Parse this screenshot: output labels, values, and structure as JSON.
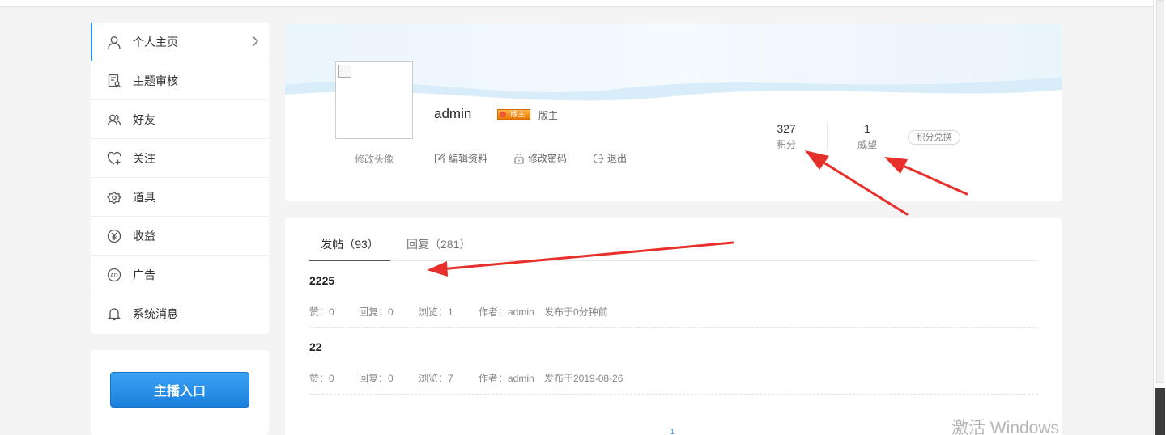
{
  "sidebar": {
    "items": [
      {
        "label": "个人主页",
        "icon": "user-icon",
        "active": true
      },
      {
        "label": "主题审核",
        "icon": "review-icon"
      },
      {
        "label": "好友",
        "icon": "friends-icon"
      },
      {
        "label": "关注",
        "icon": "heart-plus-icon"
      },
      {
        "label": "道具",
        "icon": "tools-icon"
      },
      {
        "label": "收益",
        "icon": "yen-icon"
      },
      {
        "label": "广告",
        "icon": "ad-icon"
      },
      {
        "label": "系统消息",
        "icon": "bell-icon"
      }
    ],
    "live_button": "主播入口"
  },
  "profile": {
    "username": "admin",
    "badge": "版主",
    "role": "版主",
    "edit_avatar": "修改头像",
    "actions": {
      "edit_profile": "编辑资料",
      "change_password": "修改密码",
      "logout": "退出"
    },
    "stats": {
      "points_value": "327",
      "points_label": "积分",
      "prestige_value": "1",
      "prestige_label": "威望"
    },
    "exchange": "积分兑换"
  },
  "posts": {
    "tabs": {
      "threads": "发帖（93）",
      "replies": "回复（281）"
    },
    "items": [
      {
        "title": "2225",
        "likes": "赞：0",
        "replies": "回复：0",
        "views": "浏览：1",
        "author": "作者：admin",
        "time": "发布于0分钟前"
      },
      {
        "title": "22",
        "likes": "赞：0",
        "replies": "回复：0",
        "views": "浏览：7",
        "author": "作者：admin",
        "time": "发布于2019-08-26"
      }
    ],
    "page": "1"
  },
  "watermark": "激活 Windows",
  "colors": {
    "accent": "#2b8fe8",
    "annotation_arrow": "#e8302a",
    "badge": "#ea7b00"
  }
}
